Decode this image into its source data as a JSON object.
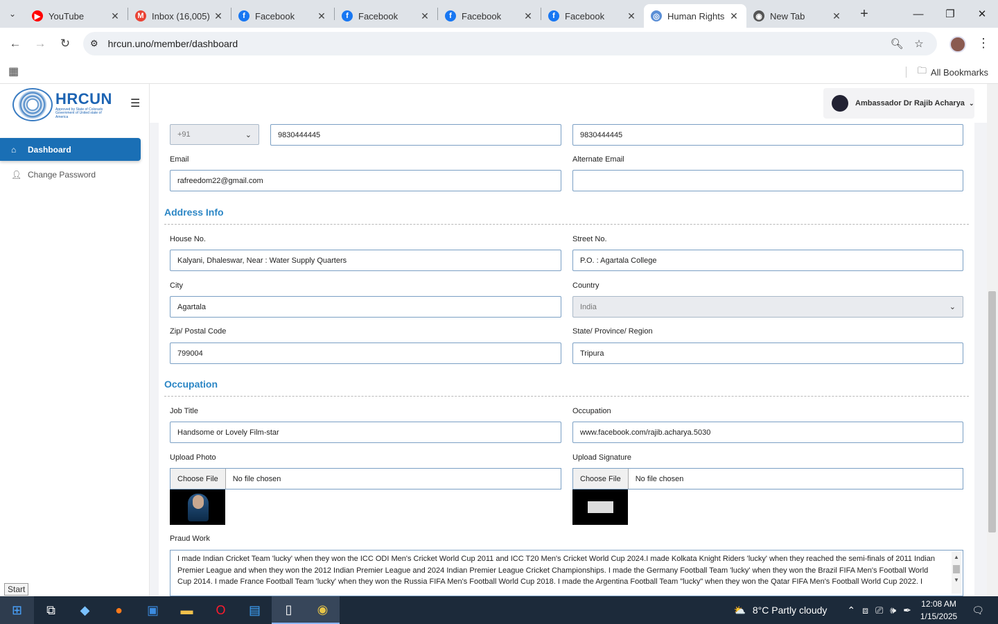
{
  "browser": {
    "tabs": [
      {
        "title": "YouTube",
        "icon": "youtube-icon",
        "color": "#ff0000",
        "glyph": "▶"
      },
      {
        "title": "Inbox (16,005)",
        "icon": "gmail-icon",
        "color": "#ea4335",
        "glyph": "M"
      },
      {
        "title": "Facebook",
        "icon": "facebook-icon",
        "color": "#1877f2",
        "glyph": "f"
      },
      {
        "title": "Facebook",
        "icon": "facebook-icon",
        "color": "#1877f2",
        "glyph": "f"
      },
      {
        "title": "Facebook",
        "icon": "facebook-icon",
        "color": "#1877f2",
        "glyph": "f"
      },
      {
        "title": "Facebook",
        "icon": "facebook-icon",
        "color": "#1877f2",
        "glyph": "f"
      },
      {
        "title": "Human Rights",
        "icon": "hrcun-icon",
        "color": "#5b8fd6",
        "glyph": "◎"
      },
      {
        "title": "New Tab",
        "icon": "chrome-icon",
        "color": "#555",
        "glyph": "◉"
      }
    ],
    "url": "hrcun.uno/member/dashboard",
    "all_bookmarks": "All Bookmarks"
  },
  "sidebar": {
    "logo_text": "HRCUN",
    "logo_subtext": "Approved by State of Colorado Government of United state of America",
    "items": [
      {
        "label": "Dashboard",
        "icon": "home-icon"
      },
      {
        "label": "Change Password",
        "icon": "user-icon"
      }
    ]
  },
  "header": {
    "user_name": "Ambassador Dr Rajib Acharya"
  },
  "form": {
    "phone_code": "+91",
    "phone": "9830444445",
    "whatsapp": "9830444445",
    "email_label": "Email",
    "email": "rafreedom22@gmail.com",
    "alt_email_label": "Alternate Email",
    "alt_email": "",
    "address_section": "Address Info",
    "house_label": "House No.",
    "house": "Kalyani, Dhaleswar, Near : Water Supply Quarters",
    "street_label": "Street No.",
    "street": "P.O. : Agartala College",
    "city_label": "City",
    "city": "Agartala",
    "country_label": "Country",
    "country": "India",
    "zip_label": "Zip/ Postal Code",
    "zip": "799004",
    "state_label": "State/ Province/ Region",
    "state": "Tripura",
    "occupation_section": "Occupation",
    "job_label": "Job Title",
    "job": "Handsome or Lovely  Film-star",
    "occupation_label": "Occupation",
    "occupation": "www.facebook.com/rajib.acharya.5030",
    "photo_label": "Upload Photo",
    "signature_label": "Upload Signature",
    "choose_file": "Choose File",
    "no_file": "No file chosen",
    "praud_label": "Praud Work",
    "praud_text": "I made Indian Cricket Team 'lucky' when they won the ICC ODI Men's Cricket World Cup 2011 and ICC T20 Men's Cricket World Cup 2024.I made Kolkata Knight Riders 'lucky' when they reached the semi-finals of 2011 Indian Premier  League  and when they won the 2012 Indian Premier League and 2024 Indian Premier League Cricket Championships. I made the Germany Football Team 'lucky' when they won the Brazil FIFA Men's Football World Cup 2014. I made France Football Team 'lucky' when they won the Russia FIFA Men's Football World Cup 2018. I made the Argentina Football Team \"lucky\" when they won the Qatar FIFA Men's Football World Cup 2022. I"
  },
  "tooltip": "Start",
  "taskbar": {
    "weather": "8°C  Partly cloudy",
    "time": "12:08 AM",
    "date": "1/15/2025"
  }
}
